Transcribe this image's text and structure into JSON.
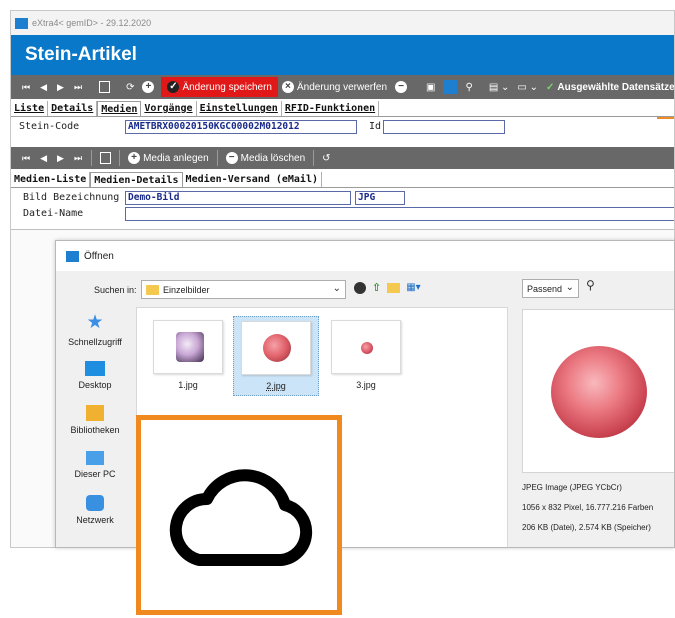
{
  "window": {
    "title": "eXtra4< gemID> - 29.12.2020",
    "banner": "Stein-Artikel"
  },
  "toolbar1": {
    "nav": [
      "⏮",
      "◀",
      "▶",
      "⏭"
    ],
    "save_changes": "Änderung speichern",
    "discard_changes": "Änderung verwerfen",
    "selected_records": "Ausgewählte Datensätze"
  },
  "tabs_main": [
    "Liste",
    "Details",
    "Medien",
    "Vorgänge",
    "Einstellungen",
    "RFID-Funktionen"
  ],
  "stein_code": {
    "label": "Stein-Code",
    "value": "AMETBRX00020150KGC00002M012012",
    "id_label": "Id",
    "id_value": ""
  },
  "toolbar2": {
    "add_media": "Media anlegen",
    "delete_media": "Media löschen"
  },
  "tabs_media": [
    "Medien-Liste",
    "Medien-Details",
    "Medien-Versand (eMail)"
  ],
  "media_details": {
    "bild_label": "Bild Bezeichnung",
    "bild_value": "Demo-Bild",
    "format_value": "JPG",
    "datei_label": "Datei-Name",
    "datei_value": ""
  },
  "dialog": {
    "title": "Öffnen",
    "look_in_label": "Suchen in:",
    "look_in_value": "Einzelbilder",
    "fit_value": "Passend",
    "places": [
      "Schnellzugriff",
      "Desktop",
      "Bibliotheken",
      "Dieser PC",
      "Netzwerk"
    ],
    "files": [
      "1.jpg",
      "2.jpg",
      "3.jpg"
    ],
    "preview_type": "JPEG Image (JPEG YCbCr)",
    "preview_dims": "1056 x 832 Pixel, 16.777.216 Farben",
    "preview_size": "206 KB (Datei), 2.574 KB (Speicher)"
  },
  "colors": {
    "accent": "#0a78c8",
    "save_red": "#e01818",
    "overlay_orange": "#f08a1e",
    "toolbar_gray": "#686868"
  }
}
